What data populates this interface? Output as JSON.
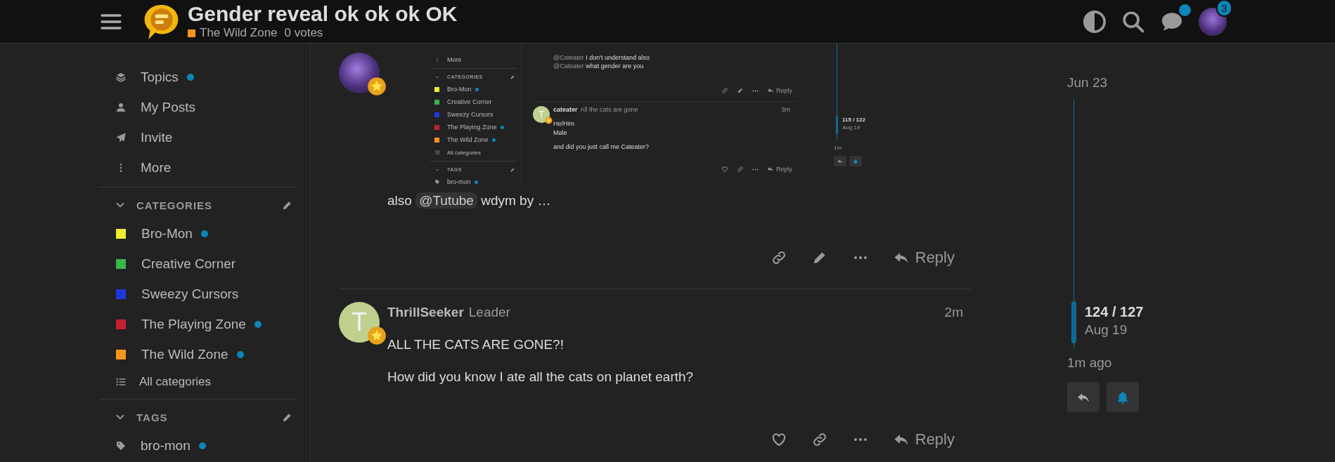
{
  "header": {
    "title": "Gender reveal ok ok ok OK",
    "category": {
      "name": "The Wild Zone",
      "color": "#f7941d"
    },
    "votes": "0 votes",
    "chat_unread": true,
    "notification_count": "3"
  },
  "sidebar": {
    "links": [
      {
        "kind": "topics",
        "label": "Topics",
        "unread": true
      },
      {
        "kind": "my_posts",
        "label": "My Posts",
        "unread": false
      },
      {
        "kind": "invite",
        "label": "Invite",
        "unread": false
      },
      {
        "kind": "more",
        "label": "More",
        "unread": false
      }
    ],
    "categories_heading": "CATEGORIES",
    "categories": [
      {
        "name": "Bro-Mon",
        "color": "#eded32",
        "unread": true
      },
      {
        "name": "Creative Corner",
        "color": "#3ab54a",
        "unread": false
      },
      {
        "name": "Sweezy Cursors",
        "color": "#1e38e0",
        "unread": false
      },
      {
        "name": "The Playing Zone",
        "color": "#c4202f",
        "unread": true
      },
      {
        "name": "The Wild Zone",
        "color": "#f7941d",
        "unread": true
      }
    ],
    "all_categories": "All categories",
    "tags_heading": "TAGS",
    "tags": [
      {
        "name": "bro-mon",
        "unread": true
      }
    ]
  },
  "posts": [
    {
      "avatar": {
        "kind": "image"
      },
      "screenshot": {
        "sidebar": {
          "links": [
            {
              "kind": "more",
              "label": "More"
            }
          ],
          "categories_heading": "CATEGORIES",
          "categories": [
            {
              "name": "Bro-Mon",
              "color": "#eded32",
              "unread": true
            },
            {
              "name": "Creative Corner",
              "color": "#3ab54a",
              "unread": false
            },
            {
              "name": "Sweezy Cursors",
              "color": "#1e38e0",
              "unread": false
            },
            {
              "name": "The Playing Zone",
              "color": "#c4202f",
              "unread": true
            },
            {
              "name": "The Wild Zone",
              "color": "#f7941d",
              "unread": true
            }
          ],
          "all_categories": "All categories",
          "tags_heading": "TAGS",
          "tags": [
            {
              "name": "bro-mon",
              "unread": true
            }
          ]
        },
        "prior_lines": [
          [
            {
              "kind": "mention",
              "text": "@Cateater"
            },
            {
              "kind": "text",
              "text": " I don't understand also"
            }
          ],
          [
            {
              "kind": "mention",
              "text": "@Cateater"
            },
            {
              "kind": "text",
              "text": " what gender are you"
            }
          ]
        ],
        "prior_actions": [
          {
            "kind": "link"
          },
          {
            "kind": "edit"
          },
          {
            "kind": "more"
          },
          {
            "kind": "reply",
            "label": "Reply"
          }
        ],
        "post": {
          "author": "cateater",
          "title": "All the cats are gone",
          "time": "3m",
          "avatar": {
            "kind": "letter",
            "letter": "T"
          },
          "lines": [
            "He/Him",
            "Male",
            "and did you just call me Cateater?"
          ],
          "actions": [
            {
              "kind": "like"
            },
            {
              "kind": "link"
            },
            {
              "kind": "more"
            },
            {
              "kind": "reply",
              "label": "Reply"
            }
          ]
        },
        "timeline": {
          "position": "115 / 122",
          "date": "Aug 19",
          "last_activity": "1m"
        }
      },
      "text": [
        {
          "kind": "text",
          "text": "also "
        },
        {
          "kind": "mention",
          "text": "@Tutube"
        },
        {
          "kind": "text",
          "text": " wdym by …"
        }
      ],
      "actions": [
        {
          "kind": "link"
        },
        {
          "kind": "edit"
        },
        {
          "kind": "more"
        },
        {
          "kind": "reply",
          "label": "Reply"
        }
      ]
    },
    {
      "avatar": {
        "kind": "letter",
        "letter": "T"
      },
      "author": "ThrillSeeker",
      "title": "Leader",
      "time": "2m",
      "paragraphs": [
        "ALL THE CATS ARE GONE?!",
        "How did you know I ate all the cats on planet earth?"
      ],
      "actions": [
        {
          "kind": "like"
        },
        {
          "kind": "link"
        },
        {
          "kind": "more"
        },
        {
          "kind": "reply",
          "label": "Reply"
        }
      ]
    }
  ],
  "timeline": {
    "start_date": "Jun 23",
    "position": "124 / 127",
    "date": "Aug 19",
    "last_activity": "1m ago"
  }
}
